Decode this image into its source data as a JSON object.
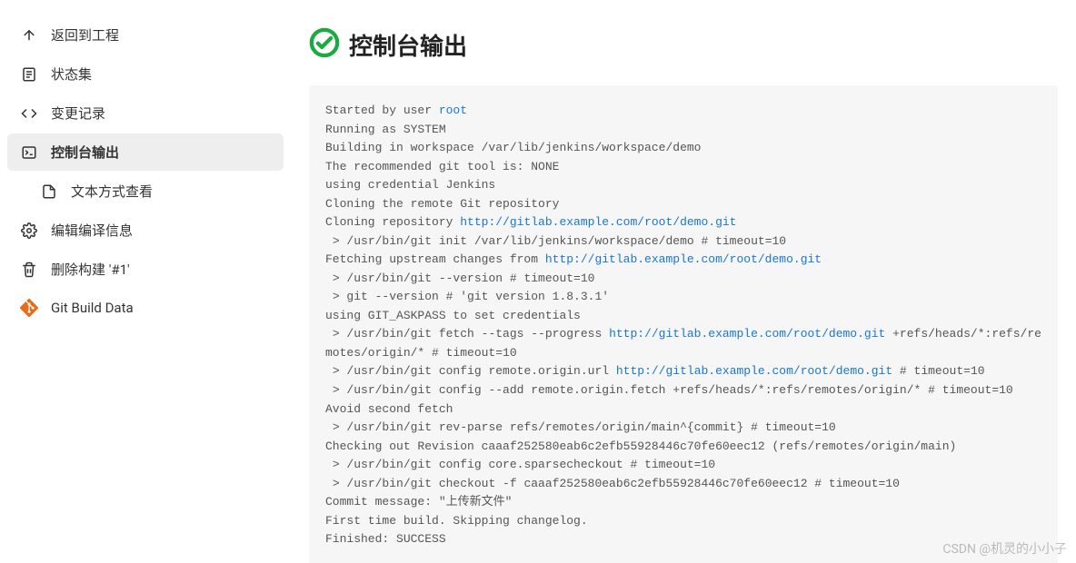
{
  "sidebar": {
    "items": [
      {
        "label": "返回到工程",
        "icon": "arrow-up-icon"
      },
      {
        "label": "状态集",
        "icon": "document-icon"
      },
      {
        "label": "变更记录",
        "icon": "code-icon"
      },
      {
        "label": "控制台输出",
        "icon": "terminal-icon",
        "active": true
      },
      {
        "label": "文本方式查看",
        "icon": "file-icon",
        "indent": true
      },
      {
        "label": "编辑编译信息",
        "icon": "gear-icon"
      },
      {
        "label": "删除构建 '#1'",
        "icon": "trash-icon"
      },
      {
        "label": "Git Build Data",
        "icon": "git-icon"
      }
    ]
  },
  "title": "控制台输出",
  "status_icon": "success",
  "console": {
    "lines": [
      {
        "segs": [
          {
            "t": "text",
            "v": "Started by user "
          },
          {
            "t": "link",
            "v": "root"
          }
        ]
      },
      {
        "segs": [
          {
            "t": "text",
            "v": "Running as SYSTEM"
          }
        ]
      },
      {
        "segs": [
          {
            "t": "text",
            "v": "Building in workspace /var/lib/jenkins/workspace/demo"
          }
        ]
      },
      {
        "segs": [
          {
            "t": "text",
            "v": "The recommended git tool is: NONE"
          }
        ]
      },
      {
        "segs": [
          {
            "t": "text",
            "v": "using credential Jenkins"
          }
        ]
      },
      {
        "segs": [
          {
            "t": "text",
            "v": "Cloning the remote Git repository"
          }
        ]
      },
      {
        "segs": [
          {
            "t": "text",
            "v": "Cloning repository "
          },
          {
            "t": "link",
            "v": "http://gitlab.example.com/root/demo.git"
          }
        ]
      },
      {
        "segs": [
          {
            "t": "text",
            "v": " > /usr/bin/git init /var/lib/jenkins/workspace/demo # timeout=10"
          }
        ]
      },
      {
        "segs": [
          {
            "t": "text",
            "v": "Fetching upstream changes from "
          },
          {
            "t": "link",
            "v": "http://gitlab.example.com/root/demo.git"
          }
        ]
      },
      {
        "segs": [
          {
            "t": "text",
            "v": " > /usr/bin/git --version # timeout=10"
          }
        ]
      },
      {
        "segs": [
          {
            "t": "text",
            "v": " > git --version # 'git version 1.8.3.1'"
          }
        ]
      },
      {
        "segs": [
          {
            "t": "text",
            "v": "using GIT_ASKPASS to set credentials "
          }
        ]
      },
      {
        "segs": [
          {
            "t": "text",
            "v": " > /usr/bin/git fetch --tags --progress "
          },
          {
            "t": "link",
            "v": "http://gitlab.example.com/root/demo.git"
          },
          {
            "t": "text",
            "v": " +refs/heads/*:refs/remotes/origin/* # timeout=10"
          }
        ]
      },
      {
        "segs": [
          {
            "t": "text",
            "v": " > /usr/bin/git config remote.origin.url "
          },
          {
            "t": "link",
            "v": "http://gitlab.example.com/root/demo.git"
          },
          {
            "t": "text",
            "v": " # timeout=10"
          }
        ]
      },
      {
        "segs": [
          {
            "t": "text",
            "v": " > /usr/bin/git config --add remote.origin.fetch +refs/heads/*:refs/remotes/origin/* # timeout=10"
          }
        ]
      },
      {
        "segs": [
          {
            "t": "text",
            "v": "Avoid second fetch"
          }
        ]
      },
      {
        "segs": [
          {
            "t": "text",
            "v": " > /usr/bin/git rev-parse refs/remotes/origin/main^{commit} # timeout=10"
          }
        ]
      },
      {
        "segs": [
          {
            "t": "text",
            "v": "Checking out Revision caaaf252580eab6c2efb55928446c70fe60eec12 (refs/remotes/origin/main)"
          }
        ]
      },
      {
        "segs": [
          {
            "t": "text",
            "v": " > /usr/bin/git config core.sparsecheckout # timeout=10"
          }
        ]
      },
      {
        "segs": [
          {
            "t": "text",
            "v": " > /usr/bin/git checkout -f caaaf252580eab6c2efb55928446c70fe60eec12 # timeout=10"
          }
        ]
      },
      {
        "segs": [
          {
            "t": "text",
            "v": "Commit message: \"上传新文件\""
          }
        ]
      },
      {
        "segs": [
          {
            "t": "text",
            "v": "First time build. Skipping changelog."
          }
        ]
      },
      {
        "segs": [
          {
            "t": "text",
            "v": "Finished: SUCCESS"
          }
        ]
      }
    ]
  },
  "watermark": "CSDN @机灵的小小子"
}
